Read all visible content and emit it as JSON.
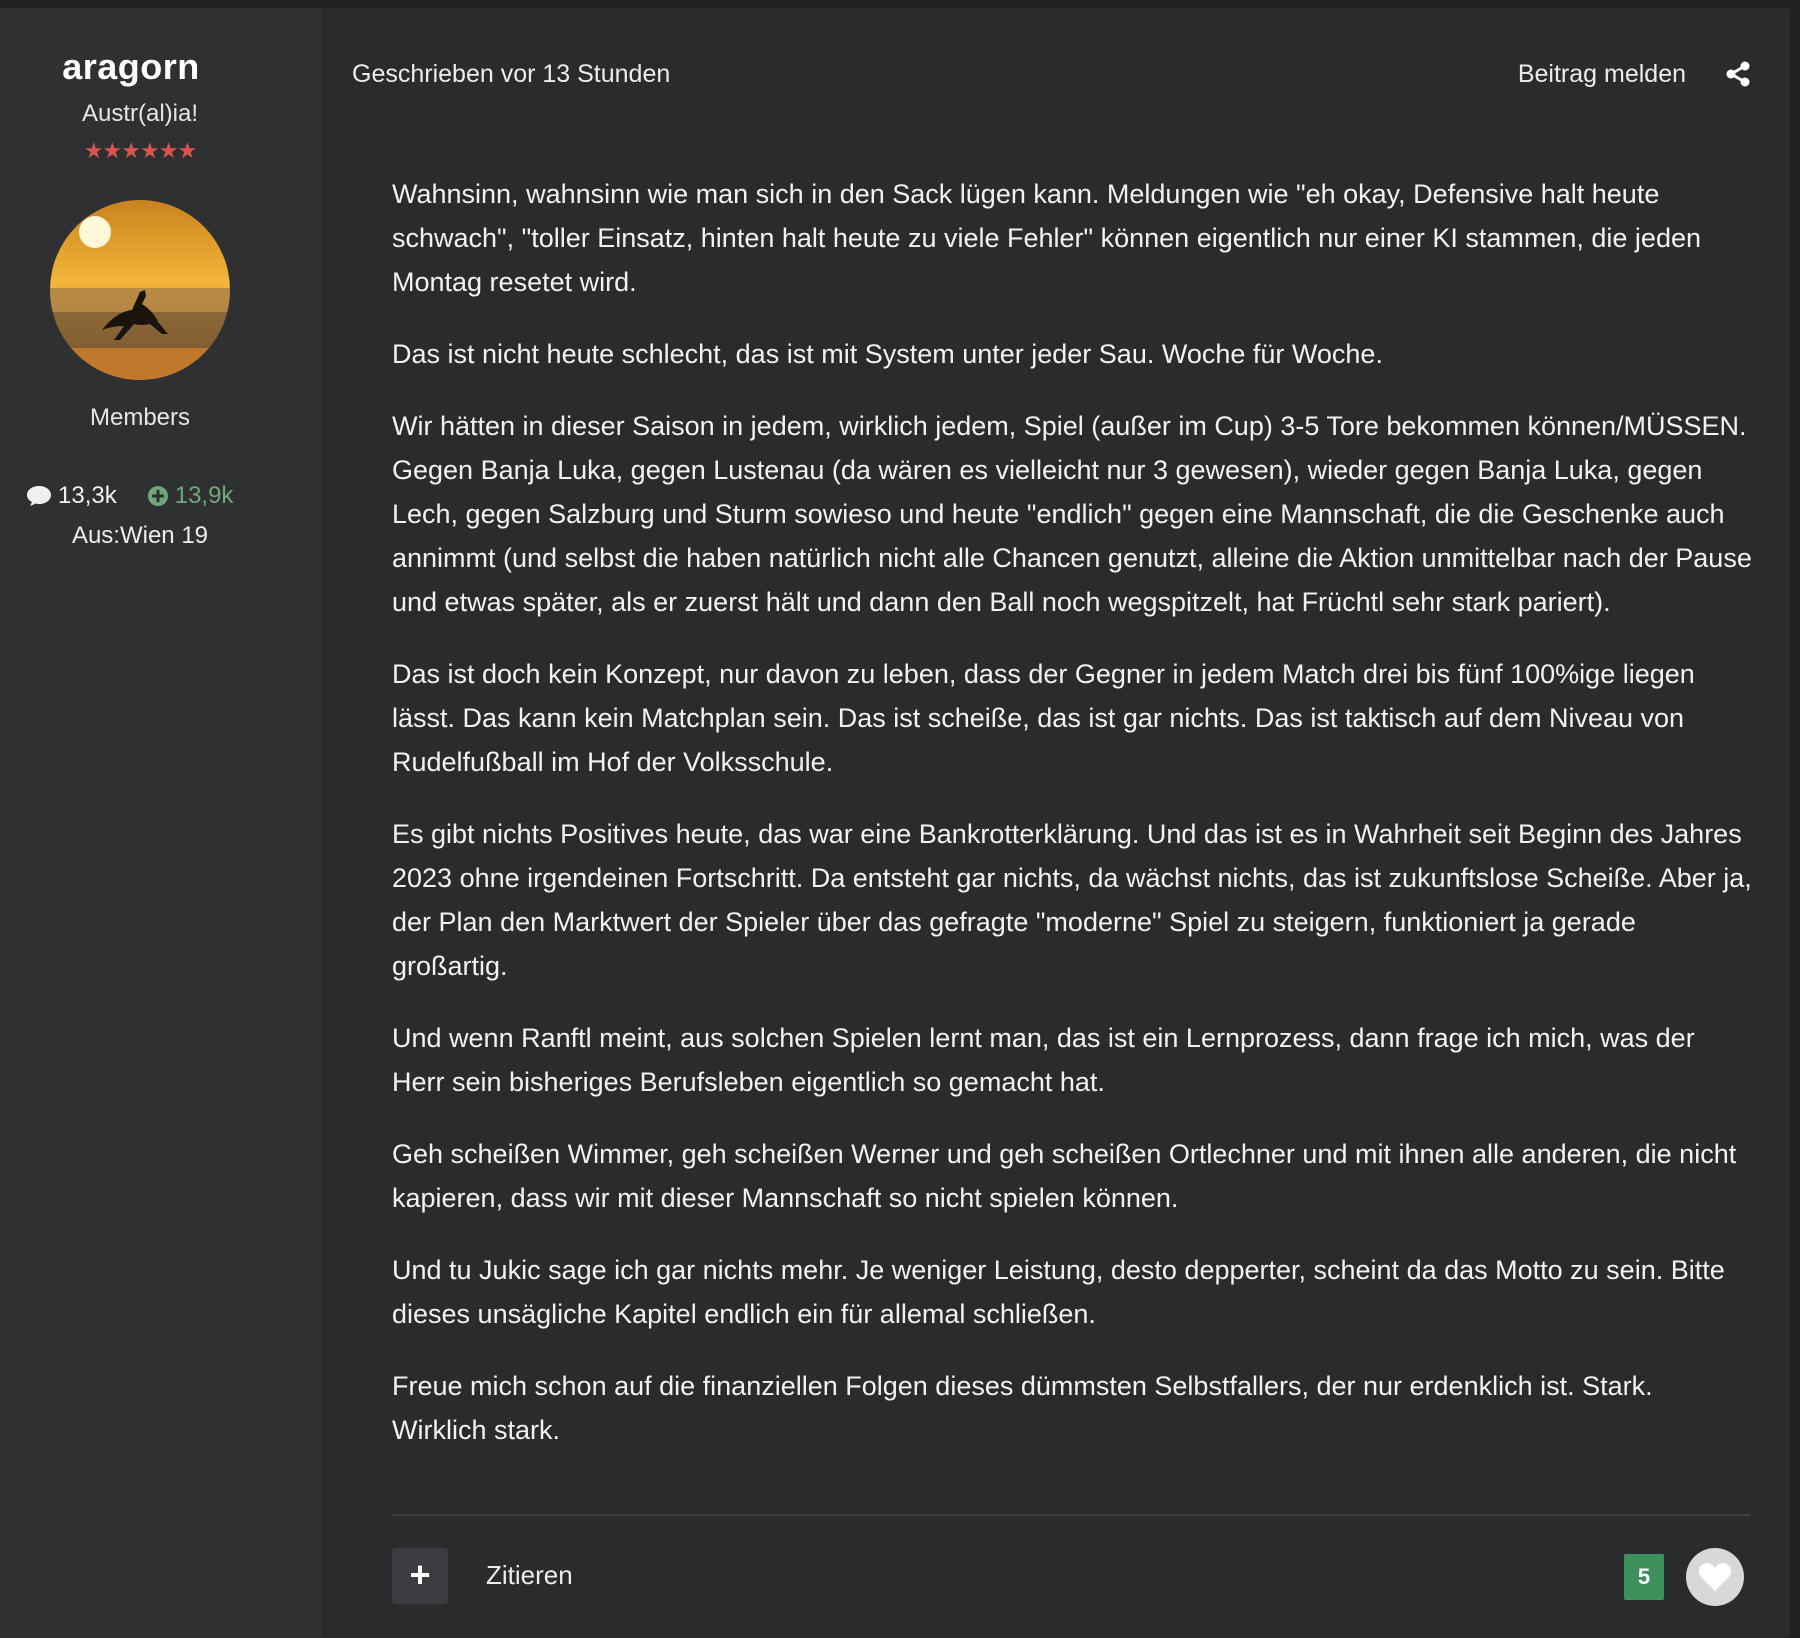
{
  "author": {
    "name": "aragorn",
    "title": "Austr(al)ia!",
    "stars": "★★★★★★",
    "group": "Members",
    "post_count": "13,3k",
    "reputation": "13,9k",
    "location": "Aus:Wien 19"
  },
  "post": {
    "meta": "Geschrieben vor 13 Stunden",
    "report_label": "Beitrag melden",
    "paragraphs": [
      "Wahnsinn, wahnsinn wie man sich in den Sack lügen kann. Meldungen wie \"eh okay, Defensive halt heute schwach\", \"toller Einsatz, hinten halt heute zu viele Fehler\" können eigentlich nur einer KI stammen, die jeden Montag resetet wird.",
      "Das ist nicht heute schlecht, das ist mit System unter jeder Sau. Woche für Woche.",
      "Wir hätten in dieser Saison in jedem, wirklich jedem, Spiel (außer im Cup) 3-5 Tore bekommen können/MÜSSEN. Gegen Banja Luka, gegen Lustenau (da wären es vielleicht nur 3 gewesen), wieder gegen Banja Luka, gegen Lech, gegen Salzburg und Sturm sowieso und heute \"endlich\" gegen eine Mannschaft, die die Geschenke auch annimmt (und selbst die haben natürlich nicht alle Chancen genutzt, alleine die Aktion unmittelbar nach der Pause und etwas später, als er zuerst hält und dann den Ball noch wegspitzelt, hat Früchtl sehr stark pariert).",
      "Das ist doch kein Konzept, nur davon zu leben, dass der Gegner in jedem Match drei bis fünf 100%ige liegen lässt. Das kann kein Matchplan sein. Das ist scheiße, das ist gar nichts. Das ist taktisch auf dem Niveau von Rudelfußball im Hof der Volksschule.",
      "Es gibt nichts Positives heute, das war eine Bankrotterklärung. Und das ist es in Wahrheit seit Beginn des Jahres 2023 ohne irgendeinen Fortschritt. Da entsteht gar nichts, da wächst nichts, das ist zukunftslose Scheiße. Aber ja, der Plan den Marktwert der Spieler über das gefragte \"moderne\" Spiel zu steigern, funktioniert ja gerade großartig.",
      "Und wenn Ranftl meint, aus solchen Spielen lernt man, das ist ein Lernprozess, dann frage ich mich, was der Herr sein bisheriges Berufsleben eigentlich so gemacht hat.",
      "Geh scheißen Wimmer, geh scheißen Werner und geh scheißen Ortlechner und mit ihnen alle anderen, die nicht kapieren, dass wir mit dieser Mannschaft so nicht spielen können.",
      "Und tu Jukic sage ich gar nichts mehr. Je weniger Leistung, desto depperter, scheint da das Motto zu sein. Bitte dieses unsägliche Kapitel endlich ein für allemal schließen.",
      "Freue mich schon auf die finanziellen Folgen dieses dümmsten Selbstfallers, der nur erdenklich ist. Stark. Wirklich stark."
    ],
    "actions": {
      "plus_label": "+",
      "quote_label": "Zitieren",
      "reaction_count": "5"
    }
  },
  "colors": {
    "background": "#2a2b2d",
    "sidebar": "#2f3032",
    "reputation_green": "#6ea879",
    "reaction_badge": "#3d8f5c",
    "stars_red": "#d9534f"
  },
  "icons": {
    "share": "share-icon",
    "comment": "comment-icon",
    "reputation": "plus-circle-icon",
    "like": "heart-icon"
  }
}
